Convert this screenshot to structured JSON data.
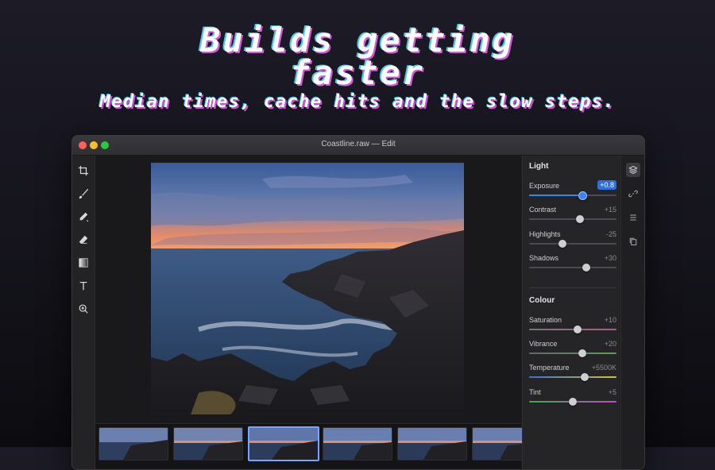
{
  "hero": {
    "title_line1": "Builds getting",
    "title_line2": "faster",
    "subtitle": "Median times, cache hits and the slow steps."
  },
  "window": {
    "title": "Coastline.raw — Edit"
  },
  "tools": [
    "crop-icon",
    "brush-icon",
    "pen-icon",
    "eraser-icon",
    "gradient-icon",
    "text-icon",
    "zoom-icon"
  ],
  "panel": {
    "light": {
      "heading": "Light",
      "sliders": [
        {
          "label": "Exposure",
          "value": "+0.8",
          "level": 0.61,
          "active": true
        },
        {
          "label": "Contrast",
          "value": "+15",
          "level": 0.58
        },
        {
          "label": "Highlights",
          "value": "-25",
          "level": 0.38
        },
        {
          "label": "Shadows",
          "value": "+30",
          "level": 0.65
        }
      ]
    },
    "colour": {
      "heading": "Colour",
      "sliders": [
        {
          "label": "Saturation",
          "value": "+10",
          "level": 0.55
        },
        {
          "label": "Vibrance",
          "value": "+20",
          "level": 0.61
        },
        {
          "label": "Temperature",
          "value": "+5500K",
          "level": 0.64
        },
        {
          "label": "Tint",
          "value": "+5",
          "level": 0.5
        }
      ]
    }
  },
  "rail_icons": [
    "layers-icon",
    "link-icon",
    "list-icon",
    "copy-icon"
  ],
  "filmstrip": {
    "count": 6,
    "selected_index": 2
  },
  "colors": {
    "accent": "#3b82f6",
    "hero_pink": "#d05ad8",
    "hero_cyan": "#46c9e9"
  }
}
